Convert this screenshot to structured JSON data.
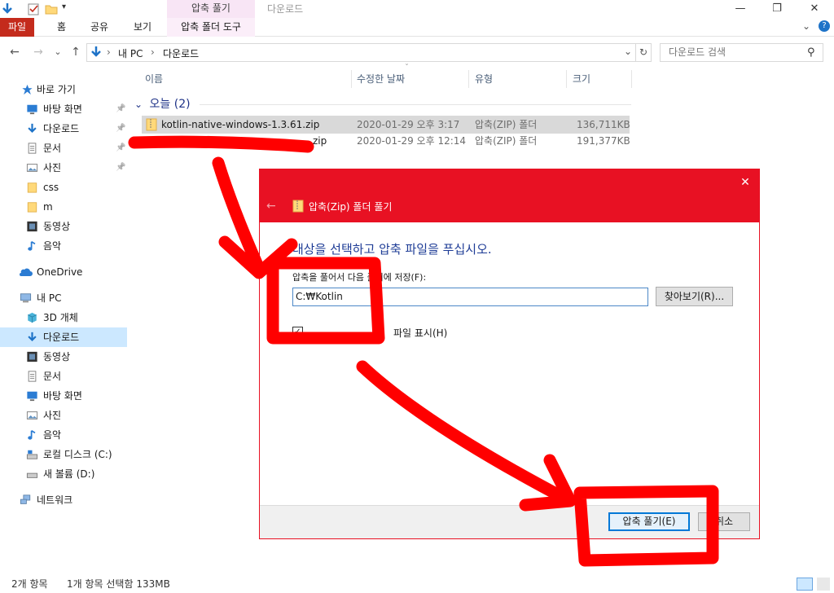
{
  "window": {
    "context_header": "압축 풀기",
    "title": "다운로드",
    "minimize_icon": "minimize-icon",
    "maximize_icon": "maximize-icon",
    "close_icon": "close-icon",
    "close_glyph": "✕",
    "minimize_glyph": "—",
    "restore_glyph": "❐"
  },
  "ribbon": {
    "tabs": [
      {
        "label": "파일"
      },
      {
        "label": "홈"
      },
      {
        "label": "공유"
      },
      {
        "label": "보기"
      },
      {
        "label": "압축 폴더 도구"
      }
    ],
    "expand_glyph": "⌄",
    "help_glyph": "?"
  },
  "navigation": {
    "back_glyph": "←",
    "forward_glyph": "→",
    "recent_glyph": "⌄",
    "up_glyph": "↑",
    "breadcrumb": [
      "내 PC",
      "다운로드"
    ],
    "separator": "›",
    "dropdown_glyph": "⌄",
    "refresh_glyph": "↻",
    "search_placeholder": "다운로드 검색",
    "search_glyph": "⚲"
  },
  "sidebar": {
    "quick_access_label": "바로 가기",
    "quick_items": [
      {
        "label": "바탕 화면",
        "pinned": true
      },
      {
        "label": "다운로드",
        "pinned": true
      },
      {
        "label": "문서",
        "pinned": true
      },
      {
        "label": "사진",
        "pinned": true
      },
      {
        "label": "css",
        "pinned": false
      },
      {
        "label": "m",
        "pinned": false
      },
      {
        "label": "동영상",
        "pinned": false
      },
      {
        "label": "음악",
        "pinned": false
      }
    ],
    "onedrive_label": "OneDrive",
    "thispc_label": "내 PC",
    "pc_items": [
      {
        "label": "3D 개체"
      },
      {
        "label": "다운로드",
        "selected": true
      },
      {
        "label": "동영상"
      },
      {
        "label": "문서"
      },
      {
        "label": "바탕 화면"
      },
      {
        "label": "사진"
      },
      {
        "label": "음악"
      },
      {
        "label": "로컬 디스크 (C:)"
      },
      {
        "label": "새 볼륨 (D:)"
      }
    ],
    "network_label": "네트워크",
    "pin_glyph": "📌"
  },
  "file_list": {
    "columns": [
      "이름",
      "수정한 날짜",
      "유형",
      "크기"
    ],
    "group_label": "오늘 (2)",
    "group_glyph": "⌄",
    "rows": [
      {
        "name": "kotlin-native-windows-1.3.61.zip",
        "date": "2020-01-29 오후 3:17",
        "type": "압축(ZIP) 폴더",
        "size": "136,711KB",
        "selected": true
      },
      {
        "name_tail": "zip",
        "date": "2020-01-29 오후 12:14",
        "type": "압축(ZIP) 폴더",
        "size": "191,377KB",
        "selected": false
      }
    ]
  },
  "status_bar": {
    "item_count": "2개 항목",
    "selection": "1개 항목 선택함 133MB"
  },
  "dialog": {
    "title": "압축(Zip) 폴더 풀기",
    "heading": "대상을 선택하고 압축 파일을 푸십시오.",
    "dest_label_left": "압축을 풀어서",
    "dest_label_right": "에 저장(F):",
    "dest_label_mid": "다음 폴더",
    "path_value": "C:₩Kotlin",
    "browse_label": "찾아보기(R)...",
    "show_files_label": "파일 표시(H)",
    "extract_label": "압축 풀기(E)",
    "cancel_label": "취소",
    "back_glyph": "←",
    "close_glyph": "✕"
  },
  "colors": {
    "accent_red": "#e81123",
    "annotation_red": "#ff0000",
    "file_tab": "#c42b1c",
    "selection": "#cce8ff"
  }
}
